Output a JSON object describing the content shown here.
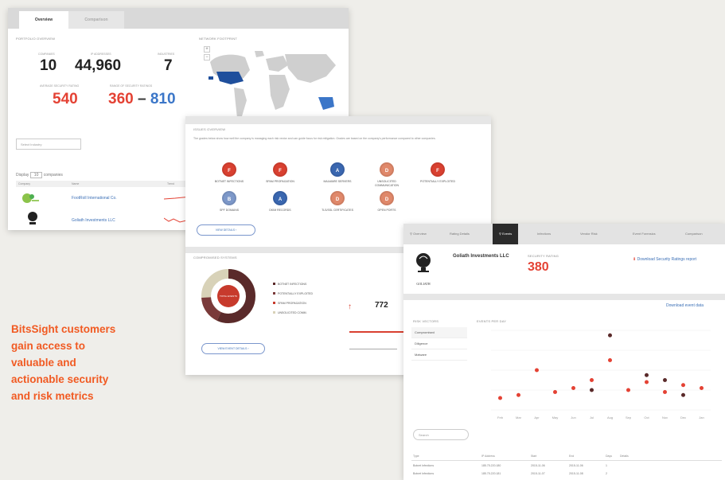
{
  "headline": [
    "BitsSight customers",
    "gain access to",
    "valuable and",
    "actionable security",
    "and risk metrics"
  ],
  "colors": {
    "accent": "#f15a22",
    "red": "#e44234",
    "blue": "#3b76c8",
    "dark": "#5a2a2a"
  },
  "portfolio": {
    "tabs": [
      "Overview",
      "Comparison"
    ],
    "section_title": "Portfolio Overview",
    "map_title": "Network Footprint",
    "kpis": [
      {
        "label": "Companies",
        "value": "10"
      },
      {
        "label": "IP Addresses",
        "value": "44,960"
      },
      {
        "label": "Industries",
        "value": "7"
      },
      {
        "label": "Average Security Rating",
        "value": "540"
      },
      {
        "label": "Range of Security Ratings",
        "value_low": "360",
        "dash": "–",
        "value_high": "810"
      }
    ],
    "filter_placeholder": "Select Industry",
    "display_label": "Display",
    "display_value": "10",
    "display_suffix": "companies",
    "table_headers": [
      "Company",
      "Name",
      "Trend"
    ],
    "companies": [
      {
        "name": "FootRoll International Co."
      },
      {
        "name": "Goliath Investments LLC"
      }
    ],
    "zoom_in": "+",
    "zoom_out": "−"
  },
  "issues": {
    "title": "Issues Overview",
    "description": "The grades below show how well the company is managing each risk vector and can guide focus for risk mitigation. Grades are based on the company's performance compared to other companies.",
    "badges": [
      {
        "letter": "F",
        "label": "Botnet Infections",
        "tone": "r"
      },
      {
        "letter": "F",
        "label": "Spam Propagation",
        "tone": "r"
      },
      {
        "letter": "A",
        "label": "Malware Servers",
        "tone": "b"
      },
      {
        "letter": "D",
        "label": "Unsolicited Communication",
        "tone": "o"
      },
      {
        "letter": "F",
        "label": "Potentially Exploited",
        "tone": "r"
      },
      {
        "letter": "B",
        "label": "SPF Domains",
        "tone": "l"
      },
      {
        "letter": "A",
        "label": "DKIM Records",
        "tone": "b"
      },
      {
        "letter": "D",
        "label": "TLS/SSL Certificates",
        "tone": "o"
      },
      {
        "letter": "D",
        "label": "Open Ports",
        "tone": "o"
      }
    ],
    "view_details": "View Details",
    "events_title": "Compromised Systems",
    "donut_center": "Total Events",
    "legend": [
      "Botnet Infections",
      "Potentially Exploited",
      "Spam Propagation",
      "Unsolicited Comm."
    ],
    "stat_value": "772",
    "view_event_details": "View Event Details"
  },
  "company": {
    "nav": [
      "Overview",
      "Rating Details",
      "Events",
      "Infections",
      "Vendor Risk",
      "Event Forensics",
      "Comparison"
    ],
    "active_nav": "Events",
    "name": "Goliath Investments LLC",
    "logo_text": "GOLIATH",
    "rating_label": "Security Rating",
    "rating": "380",
    "download_link": "Download Security Ratings report",
    "filter_title": "Risk Vectors",
    "filter_items": [
      "Compromised",
      "Diligence",
      "Malware"
    ],
    "chart_title": "Events per day",
    "download_data": "Download event data",
    "search_placeholder": "Search",
    "table_headers": [
      "Type",
      "IP Address",
      "Start",
      "End",
      "Days",
      "Details"
    ],
    "rows": [
      {
        "type": "Botnet Infections",
        "ip": "185.75.220.180",
        "start": "2015-11-06",
        "end": "2015-11-06",
        "days": "1"
      },
      {
        "type": "Botnet Infections",
        "ip": "185.75.220.181",
        "start": "2015-11-07",
        "end": "2015-11-08",
        "days": "2"
      }
    ]
  },
  "chart_data": {
    "type": "scatter",
    "title": "",
    "xlabel": "",
    "ylabel": "",
    "x": [
      "Feb",
      "Mar",
      "Apr",
      "May",
      "Jun",
      "Jul",
      "Aug",
      "Sep",
      "Oct",
      "Nov",
      "Dec",
      "Jan"
    ],
    "series": [
      {
        "values": [
          12,
          15,
          40,
          18,
          22,
          30,
          50,
          20,
          28,
          18,
          25,
          22
        ],
        "color": "#e44234"
      },
      {
        "values": [
          null,
          null,
          null,
          null,
          null,
          20,
          75,
          null,
          35,
          30,
          15,
          null
        ],
        "color": "#5a2a2a"
      }
    ],
    "ylim": [
      0,
      80
    ]
  }
}
